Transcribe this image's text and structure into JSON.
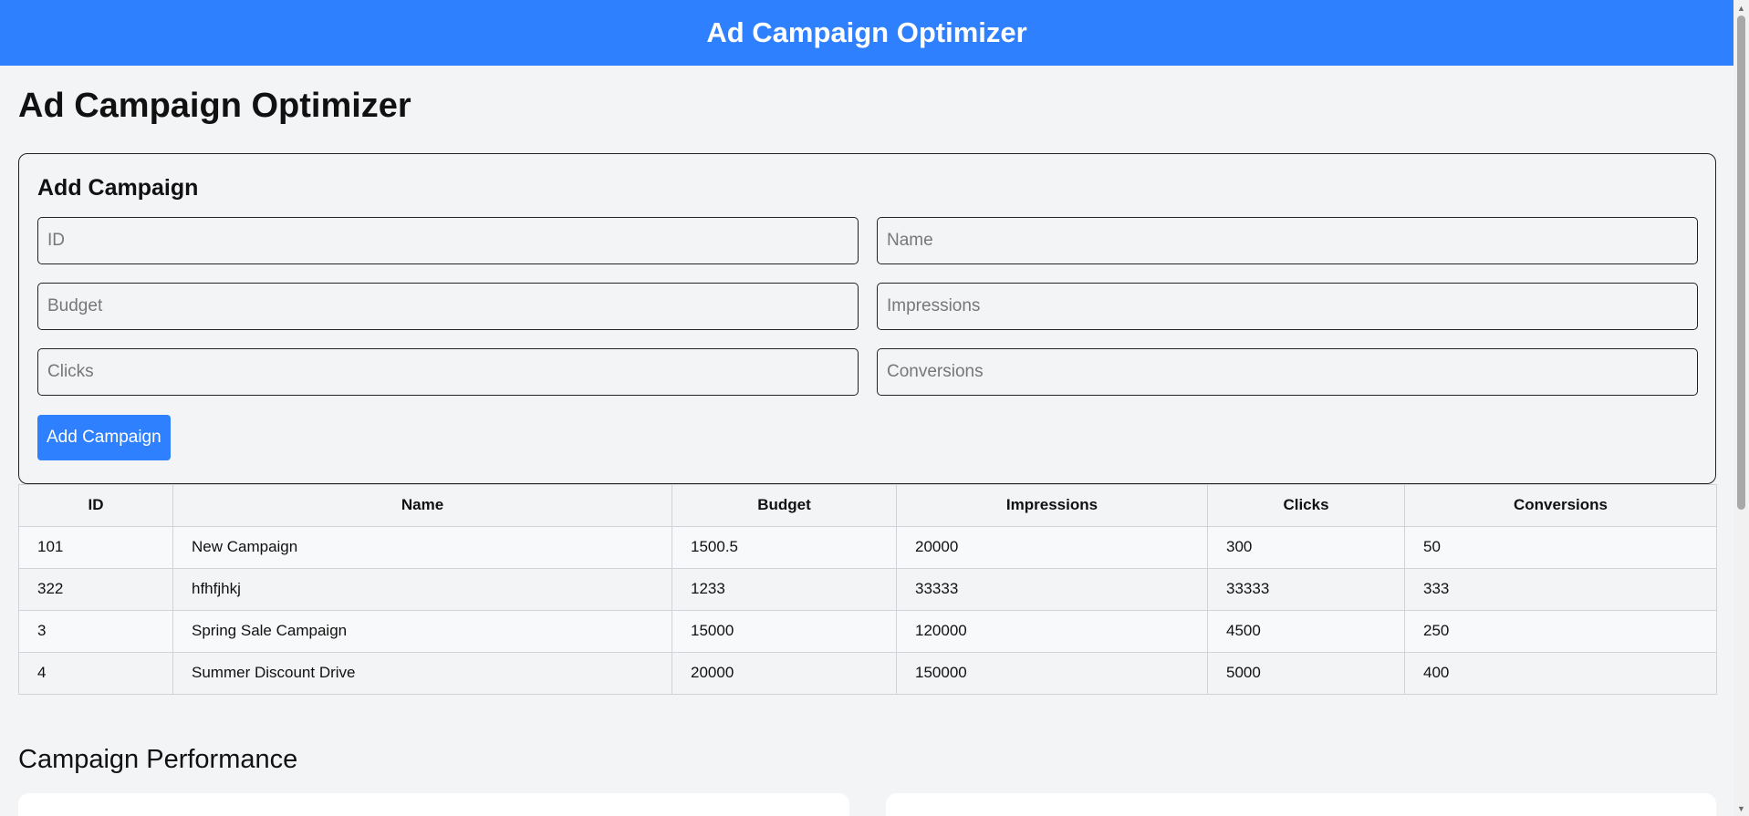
{
  "header": {
    "title": "Ad Campaign Optimizer"
  },
  "page": {
    "title": "Ad Campaign Optimizer"
  },
  "form": {
    "title": "Add Campaign",
    "fields": {
      "id": "ID",
      "name": "Name",
      "budget": "Budget",
      "impressions": "Impressions",
      "clicks": "Clicks",
      "conversions": "Conversions"
    },
    "submit_label": "Add Campaign"
  },
  "table": {
    "columns": [
      "ID",
      "Name",
      "Budget",
      "Impressions",
      "Clicks",
      "Conversions"
    ],
    "rows": [
      [
        "101",
        "New Campaign",
        "1500.5",
        "20000",
        "300",
        "50"
      ],
      [
        "322",
        "hfhfjhkj",
        "1233",
        "33333",
        "33333",
        "333"
      ],
      [
        "3",
        "Spring Sale Campaign",
        "15000",
        "120000",
        "4500",
        "250"
      ],
      [
        "4",
        "Summer Discount Drive",
        "20000",
        "150000",
        "5000",
        "400"
      ]
    ]
  },
  "performance": {
    "title": "Campaign Performance"
  },
  "colors": {
    "accent": "#2f80ff",
    "background": "#f3f4f6"
  }
}
